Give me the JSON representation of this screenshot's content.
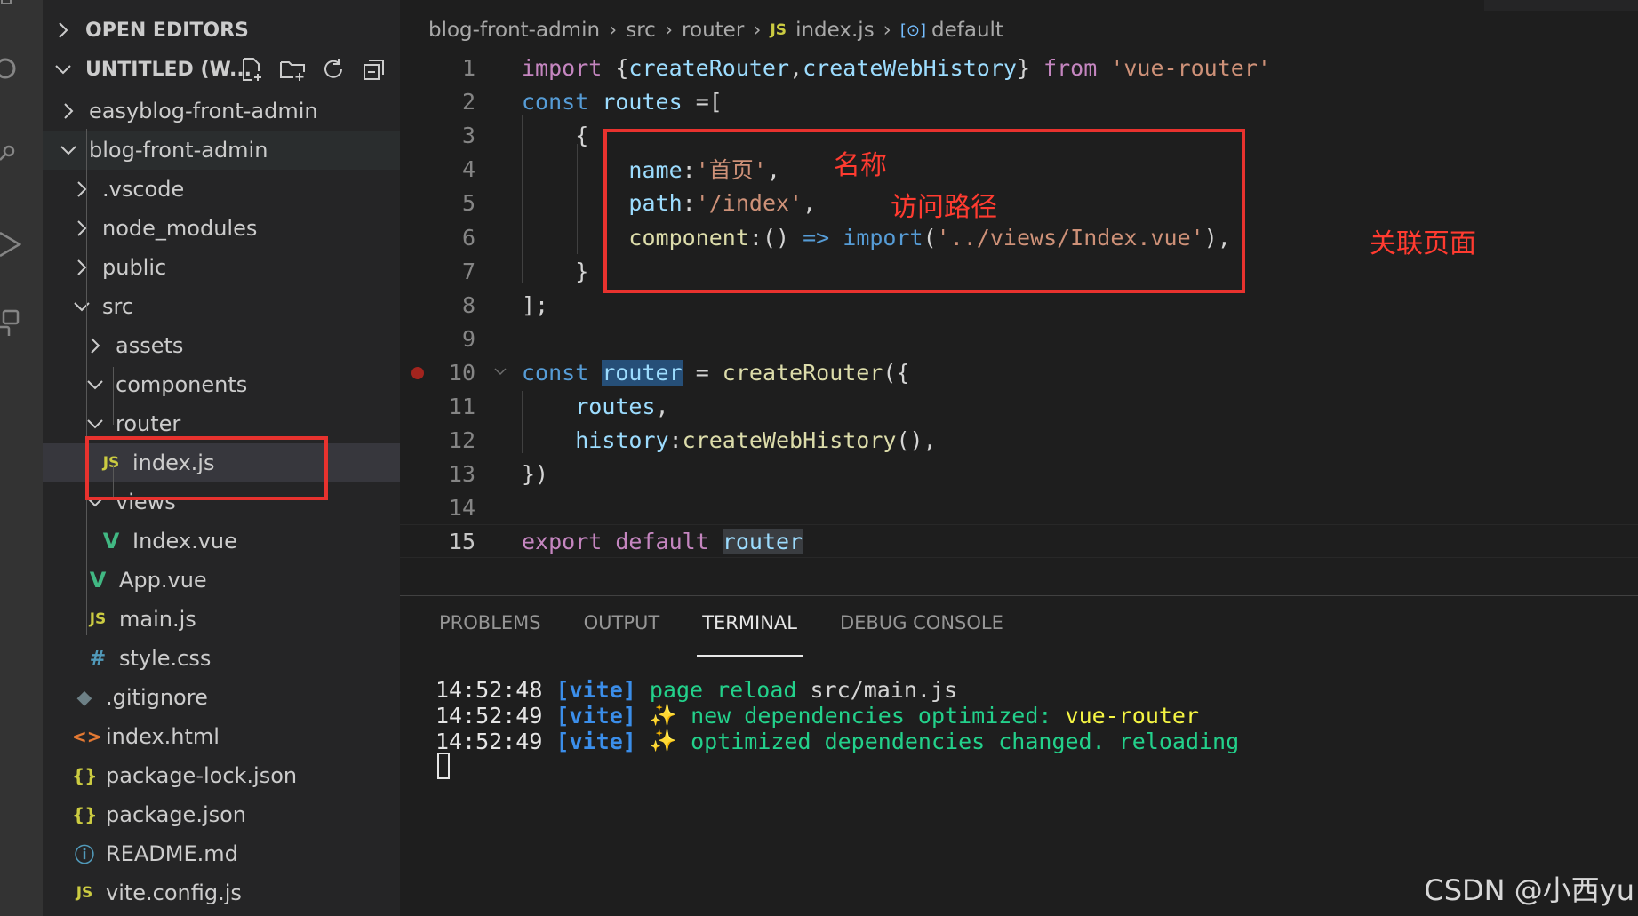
{
  "activity_bar": {
    "icons": [
      "files-icon",
      "search-icon",
      "source-control-icon",
      "run-debug-icon",
      "extensions-icon"
    ]
  },
  "sidebar": {
    "sections": {
      "open_editors": "OPEN EDITORS",
      "workspace": "UNTITLED (W..."
    },
    "actions": [
      "new-file-icon",
      "new-folder-icon",
      "refresh-icon",
      "collapse-all-icon"
    ],
    "tree": [
      {
        "label": "easyblog-front-admin",
        "kind": "folder",
        "expanded": false
      },
      {
        "label": "blog-front-admin",
        "kind": "folder",
        "expanded": true
      },
      {
        "label": ".vscode",
        "kind": "folder",
        "expanded": false
      },
      {
        "label": "node_modules",
        "kind": "folder",
        "expanded": false
      },
      {
        "label": "public",
        "kind": "folder",
        "expanded": false
      },
      {
        "label": "src",
        "kind": "folder",
        "expanded": true
      },
      {
        "label": "assets",
        "kind": "folder",
        "expanded": false
      },
      {
        "label": "components",
        "kind": "folder",
        "expanded": true
      },
      {
        "label": "router",
        "kind": "folder",
        "expanded": true
      },
      {
        "label": "index.js",
        "kind": "js",
        "icon_text": "JS",
        "selected": true
      },
      {
        "label": "views",
        "kind": "folder",
        "expanded": true
      },
      {
        "label": "Index.vue",
        "kind": "vue",
        "icon_text": "V"
      },
      {
        "label": "App.vue",
        "kind": "vue",
        "icon_text": "V"
      },
      {
        "label": "main.js",
        "kind": "js",
        "icon_text": "JS"
      },
      {
        "label": "style.css",
        "kind": "css",
        "icon_text": "#"
      },
      {
        "label": ".gitignore",
        "kind": "git",
        "icon_text": "◆"
      },
      {
        "label": "index.html",
        "kind": "html",
        "icon_text": "<>"
      },
      {
        "label": "package-lock.json",
        "kind": "json",
        "icon_text": "{}"
      },
      {
        "label": "package.json",
        "kind": "json",
        "icon_text": "{}"
      },
      {
        "label": "README.md",
        "kind": "info",
        "icon_text": "ⓘ"
      },
      {
        "label": "vite.config.js",
        "kind": "js",
        "icon_text": "JS"
      }
    ]
  },
  "breadcrumb": {
    "items": [
      "blog-front-admin",
      "src",
      "router",
      "index.js",
      "default"
    ],
    "file_icon_text": "JS",
    "symbol_icon_text": "[⊙]"
  },
  "editor": {
    "lines": [
      {
        "n": "1",
        "tokens": [
          [
            "kw2",
            "import"
          ],
          [
            "pl",
            " {"
          ],
          [
            "vr",
            "createRouter"
          ],
          [
            "pl",
            ","
          ],
          [
            "vr",
            "createWebHistory"
          ],
          [
            "pl",
            "} "
          ],
          [
            "kw2",
            "from"
          ],
          [
            "pl",
            " "
          ],
          [
            "str",
            "'vue-router'"
          ]
        ]
      },
      {
        "n": "2",
        "tokens": [
          [
            "kw",
            "const"
          ],
          [
            "pl",
            " "
          ],
          [
            "vr",
            "routes"
          ],
          [
            "pl",
            " =["
          ]
        ]
      },
      {
        "n": "3",
        "tokens": [
          [
            "pl",
            "    {"
          ]
        ]
      },
      {
        "n": "4",
        "tokens": [
          [
            "pl",
            "        "
          ],
          [
            "vr",
            "name"
          ],
          [
            "pl",
            ":"
          ],
          [
            "str",
            "'首页'"
          ],
          [
            "pl",
            ","
          ]
        ]
      },
      {
        "n": "5",
        "tokens": [
          [
            "pl",
            "        "
          ],
          [
            "vr",
            "path"
          ],
          [
            "pl",
            ":"
          ],
          [
            "str",
            "'/index'"
          ],
          [
            "pl",
            ","
          ]
        ]
      },
      {
        "n": "6",
        "tokens": [
          [
            "pl",
            "        "
          ],
          [
            "fn",
            "component"
          ],
          [
            "pl",
            ":() "
          ],
          [
            "kw",
            "=>"
          ],
          [
            "pl",
            " "
          ],
          [
            "kw",
            "import"
          ],
          [
            "pl",
            "("
          ],
          [
            "str",
            "'../views/Index.vue'"
          ],
          [
            "pl",
            "),"
          ]
        ]
      },
      {
        "n": "7",
        "tokens": [
          [
            "pl",
            "    }"
          ]
        ]
      },
      {
        "n": "8",
        "tokens": [
          [
            "pl",
            "];"
          ]
        ]
      },
      {
        "n": "9",
        "tokens": []
      },
      {
        "n": "10",
        "tokens": [
          [
            "kw",
            "const"
          ],
          [
            "pl",
            " "
          ],
          [
            "vr hl",
            "router"
          ],
          [
            "pl",
            " = "
          ],
          [
            "fn",
            "createRouter"
          ],
          [
            "pl",
            "({"
          ]
        ]
      },
      {
        "n": "11",
        "tokens": [
          [
            "pl",
            "    "
          ],
          [
            "vr",
            "routes"
          ],
          [
            "pl",
            ","
          ]
        ]
      },
      {
        "n": "12",
        "tokens": [
          [
            "pl",
            "    "
          ],
          [
            "vr",
            "history"
          ],
          [
            "pl",
            ":"
          ],
          [
            "fn",
            "createWebHistory"
          ],
          [
            "pl",
            "(),"
          ]
        ]
      },
      {
        "n": "13",
        "tokens": [
          [
            "pl",
            "})"
          ]
        ]
      },
      {
        "n": "14",
        "tokens": []
      },
      {
        "n": "15",
        "tokens": [
          [
            "kw2",
            "export"
          ],
          [
            "pl",
            " "
          ],
          [
            "kw2",
            "default"
          ],
          [
            "pl",
            " "
          ],
          [
            "vr hl2",
            "router"
          ]
        ]
      }
    ],
    "current_line": "15",
    "breakpoint_line": "10"
  },
  "annotations": {
    "name_label": "名称",
    "path_label": "访问路径",
    "component_label": "关联页面",
    "box_color": "#e8322e"
  },
  "panel": {
    "tabs": [
      "PROBLEMS",
      "OUTPUT",
      "TERMINAL",
      "DEBUG CONSOLE"
    ],
    "active_tab": "TERMINAL",
    "terminal": [
      {
        "time": "14:52:48",
        "tag": "[vite]",
        "spark": "",
        "msg": "page reload",
        "extra": "src/main.js"
      },
      {
        "time": "14:52:49",
        "tag": "[vite]",
        "spark": "✨",
        "msg": "new dependencies optimized:",
        "extra": "vue-router"
      },
      {
        "time": "14:52:49",
        "tag": "[vite]",
        "spark": "✨",
        "msg": "optimized dependencies changed. reloading",
        "extra": ""
      }
    ]
  },
  "watermark": "CSDN @小西yu"
}
